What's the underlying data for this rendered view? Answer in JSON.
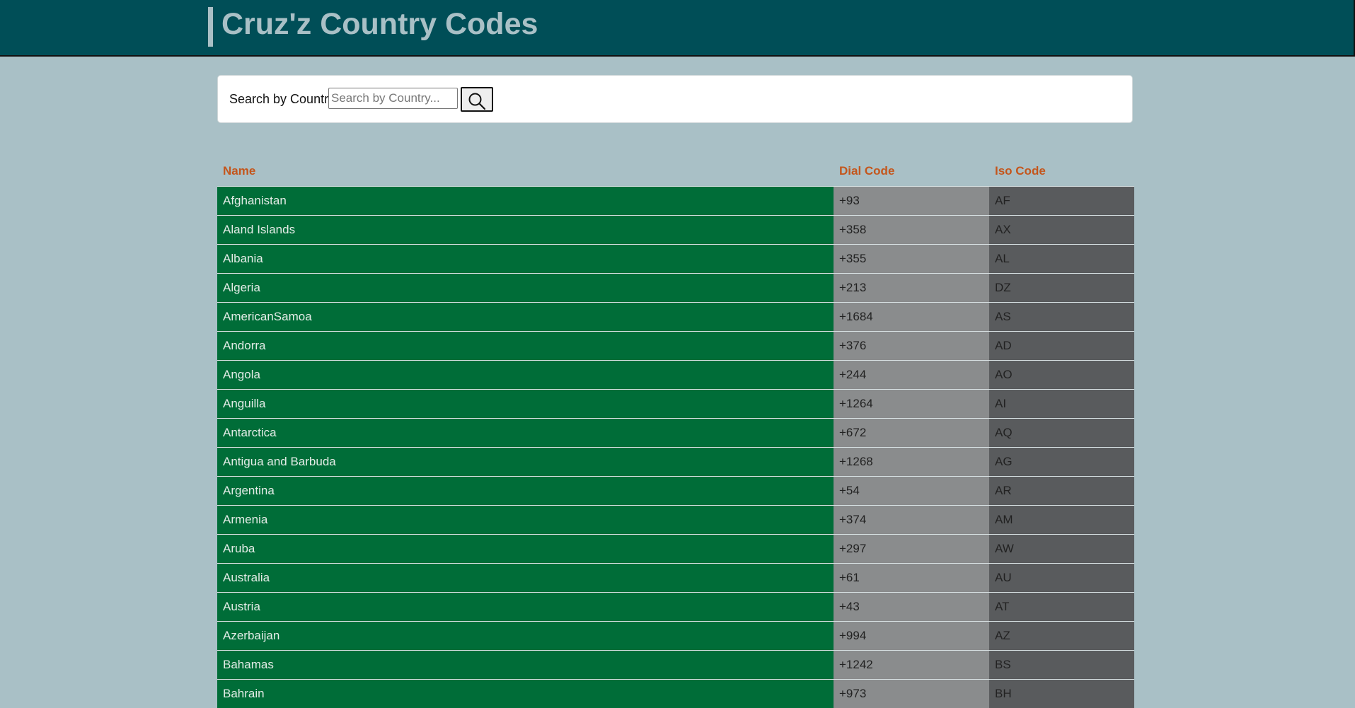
{
  "header": {
    "title": "Cruz'z Country Codes"
  },
  "search": {
    "label": "Search by Country",
    "placeholder": "Search by Country...",
    "value": ""
  },
  "table": {
    "columns": [
      "Name",
      "Dial Code",
      "Iso Code"
    ],
    "rows": [
      [
        "Afghanistan",
        "+93",
        "AF"
      ],
      [
        "Aland Islands",
        "+358",
        "AX"
      ],
      [
        "Albania",
        "+355",
        "AL"
      ],
      [
        "Algeria",
        "+213",
        "DZ"
      ],
      [
        "AmericanSamoa",
        "+1684",
        "AS"
      ],
      [
        "Andorra",
        "+376",
        "AD"
      ],
      [
        "Angola",
        "+244",
        "AO"
      ],
      [
        "Anguilla",
        "+1264",
        "AI"
      ],
      [
        "Antarctica",
        "+672",
        "AQ"
      ],
      [
        "Antigua and Barbuda",
        "+1268",
        "AG"
      ],
      [
        "Argentina",
        "+54",
        "AR"
      ],
      [
        "Armenia",
        "+374",
        "AM"
      ],
      [
        "Aruba",
        "+297",
        "AW"
      ],
      [
        "Australia",
        "+61",
        "AU"
      ],
      [
        "Austria",
        "+43",
        "AT"
      ],
      [
        "Azerbaijan",
        "+994",
        "AZ"
      ],
      [
        "Bahamas",
        "+1242",
        "BS"
      ],
      [
        "Bahrain",
        "+973",
        "BH"
      ]
    ]
  }
}
